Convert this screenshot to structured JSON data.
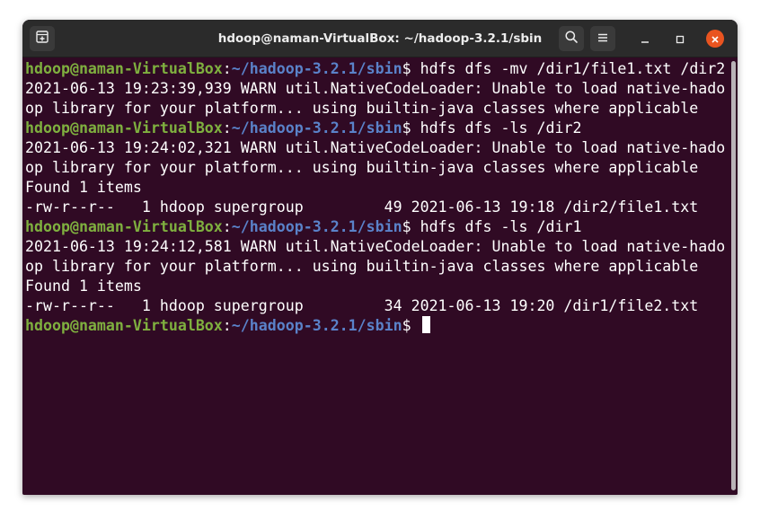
{
  "window": {
    "title": "hdoop@naman-VirtualBox: ~/hadoop-3.2.1/sbin"
  },
  "icons": {
    "new_tab": "new-tab-icon",
    "search": "search-icon",
    "menu": "hamburger-menu-icon",
    "minimize": "minimize-icon",
    "maximize": "maximize-icon",
    "close": "close-icon"
  },
  "colors": {
    "terminal_background": "#300a24",
    "prompt_user": "#7fb03f",
    "prompt_path": "#5a82c9",
    "close_button": "#e95420"
  },
  "terminal": {
    "lines": [
      {
        "type": "prompt",
        "user": "hdoop@naman-VirtualBox",
        "sep": ":",
        "path": "~/hadoop-3.2.1/sbin",
        "cmd": "$ hdfs dfs -mv /dir1/file1.txt /dir2"
      },
      {
        "type": "output",
        "text": "2021-06-13 19:23:39,939 WARN util.NativeCodeLoader: Unable to load native-hado"
      },
      {
        "type": "output",
        "text": "op library for your platform... using builtin-java classes where applicable"
      },
      {
        "type": "prompt",
        "user": "hdoop@naman-VirtualBox",
        "sep": ":",
        "path": "~/hadoop-3.2.1/sbin",
        "cmd": "$ hdfs dfs -ls /dir2"
      },
      {
        "type": "output",
        "text": "2021-06-13 19:24:02,321 WARN util.NativeCodeLoader: Unable to load native-hado"
      },
      {
        "type": "output",
        "text": "op library for your platform... using builtin-java classes where applicable"
      },
      {
        "type": "output",
        "text": "Found 1 items"
      },
      {
        "type": "output",
        "text": "-rw-r--r--   1 hdoop supergroup         49 2021-06-13 19:18 /dir2/file1.txt"
      },
      {
        "type": "prompt",
        "user": "hdoop@naman-VirtualBox",
        "sep": ":",
        "path": "~/hadoop-3.2.1/sbin",
        "cmd": "$ hdfs dfs -ls /dir1"
      },
      {
        "type": "output",
        "text": "2021-06-13 19:24:12,581 WARN util.NativeCodeLoader: Unable to load native-hado"
      },
      {
        "type": "output",
        "text": "op library for your platform... using builtin-java classes where applicable"
      },
      {
        "type": "output",
        "text": "Found 1 items"
      },
      {
        "type": "output",
        "text": "-rw-r--r--   1 hdoop supergroup         34 2021-06-13 19:20 /dir1/file2.txt"
      },
      {
        "type": "prompt",
        "user": "hdoop@naman-VirtualBox",
        "sep": ":",
        "path": "~/hadoop-3.2.1/sbin",
        "cmd": "$ ",
        "cursor": true
      }
    ]
  }
}
